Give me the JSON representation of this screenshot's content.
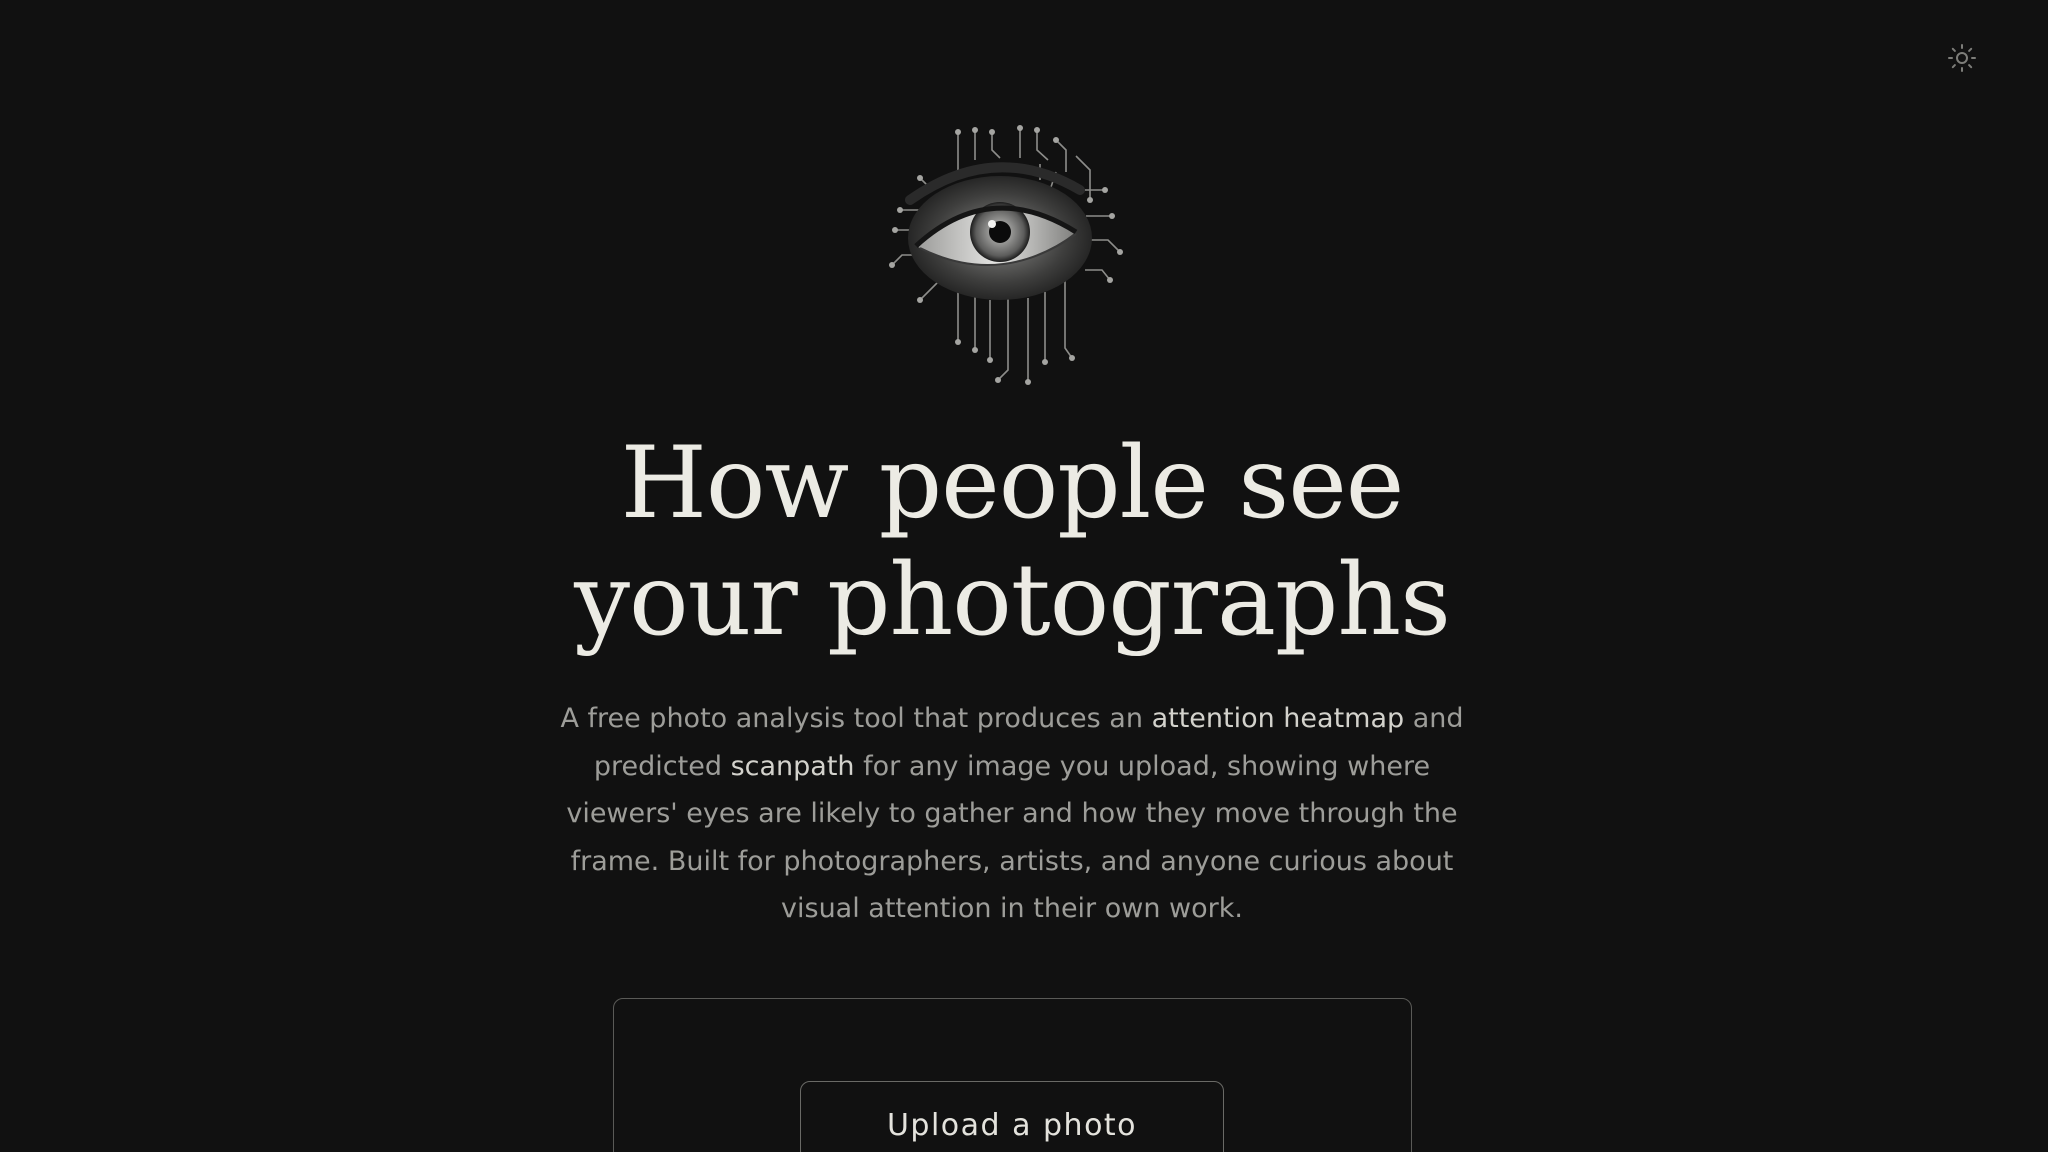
{
  "header": {
    "theme_toggle_icon": "sun-icon"
  },
  "hero": {
    "image_icon": "circuit-eye-illustration",
    "headline_line1": "How people see",
    "headline_line2": "your photographs",
    "intro": {
      "part1": "A free photo analysis tool that produces an ",
      "strong1": "attention heatmap",
      "part2": " and predicted ",
      "strong2": "scanpath",
      "part3": " for any image you upload, showing where viewers' eyes are likely to gather and how they move through the frame. Built for photographers, artists, and anyone curious about visual attention in their own work."
    }
  },
  "upload": {
    "button_label": "Upload a photo"
  },
  "colors": {
    "background": "#111111",
    "headline": "#ecebe4",
    "body_text": "#9d9d99",
    "emphasis_text": "#d3d2cc",
    "border": "#5a5a57"
  }
}
